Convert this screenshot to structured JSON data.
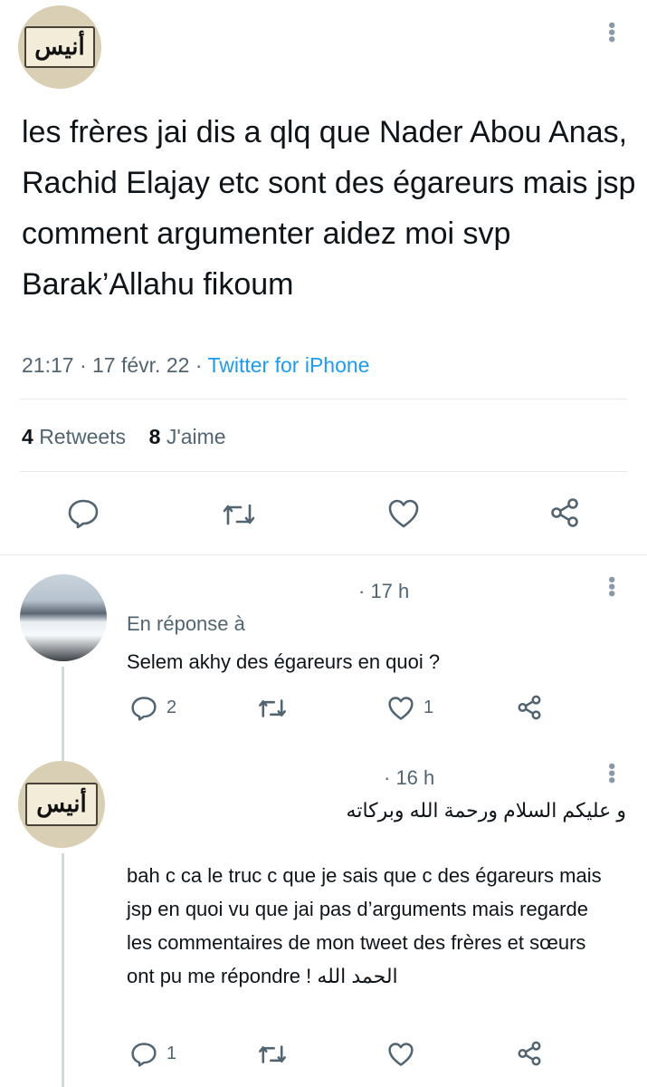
{
  "tweet": {
    "avatar_text": "أنيس",
    "text": "les frères jai dis a qlq que Nader Abou Anas, Rachid Elajay etc sont des égareurs mais jsp comment argumenter aidez moi svp Barak’Allahu fikoum",
    "time": "21:17",
    "date": "17 févr. 22",
    "separator": "·",
    "source": "Twitter for iPhone",
    "retweets_count": "4",
    "retweets_label": "Retweets",
    "likes_count": "8",
    "likes_label": "J'aime"
  },
  "replies": [
    {
      "time": "· 17 h",
      "replying_label": "En réponse à",
      "text": "Selem akhy des égareurs en quoi ?",
      "reply_count": "2",
      "retweet_count": "",
      "like_count": "1"
    },
    {
      "avatar_text": "أنيس",
      "time": "· 16 h",
      "arabic_line": "و عليكم السلام ورحمة الله وبركاته",
      "text": "bah c ca le truc c que je sais que c des égareurs mais jsp en quoi vu que jai pas d’arguments mais regarde les commentaires de mon tweet des frères et sœurs ont pu me répondre ! الحمد الله",
      "reply_count": "1",
      "retweet_count": "",
      "like_count": ""
    }
  ],
  "icons": {
    "reply": "speech-bubble-icon",
    "retweet": "retweet-arrows-icon",
    "like": "heart-icon",
    "share": "share-nodes-icon",
    "more": "vertical-dots-icon"
  },
  "colors": {
    "text": "#0f1419",
    "secondary": "#536471",
    "link": "#1d9bf0",
    "divider": "#e6e9eb"
  }
}
